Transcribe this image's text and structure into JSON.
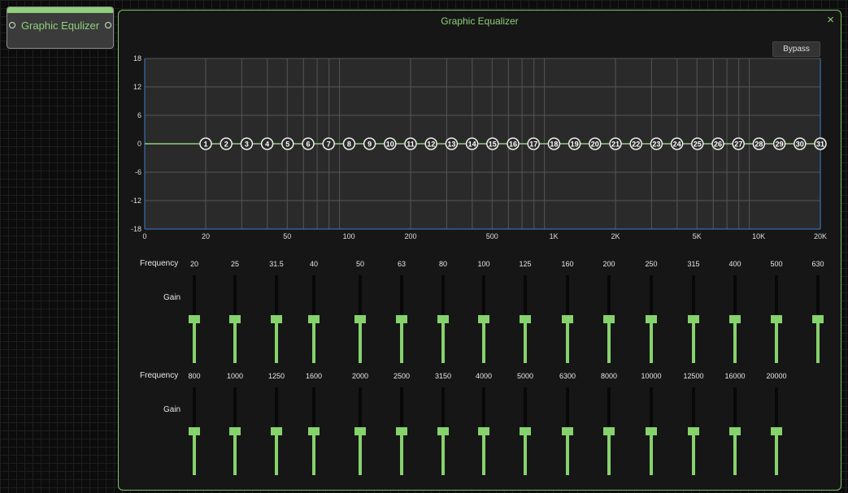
{
  "node": {
    "title": "Graphic Equlizer"
  },
  "window": {
    "title": "Graphic Equalizer",
    "close_glyph": "×",
    "bypass_label": "Bypass"
  },
  "graph": {
    "y_ticks": [
      "18",
      "12",
      "6",
      "0",
      "-6",
      "-12",
      "-18"
    ],
    "x_ticks": [
      {
        "freq": 20,
        "label": "20"
      },
      {
        "freq": 50,
        "label": "50"
      },
      {
        "freq": 100,
        "label": "100"
      },
      {
        "freq": 200,
        "label": "200"
      },
      {
        "freq": 500,
        "label": "500"
      },
      {
        "freq": 1000,
        "label": "1K"
      },
      {
        "freq": 2000,
        "label": "2K"
      },
      {
        "freq": 5000,
        "label": "5K"
      },
      {
        "freq": 10000,
        "label": "10K"
      },
      {
        "freq": 20000,
        "label": "20K"
      }
    ],
    "x_axis_origin_label": "0",
    "bands": [
      "1",
      "2",
      "3",
      "4",
      "5",
      "6",
      "7",
      "8",
      "9",
      "10",
      "11",
      "12",
      "13",
      "14",
      "15",
      "16",
      "17",
      "18",
      "19",
      "20",
      "21",
      "22",
      "23",
      "24",
      "25",
      "26",
      "27",
      "28",
      "29",
      "30",
      "31"
    ],
    "band_gain_db": 0,
    "colors": {
      "curve": "#8fd07a",
      "grid": "#555555",
      "axis": "#3b7fd0",
      "plot_bg": "#2a2a2a"
    }
  },
  "labels": {
    "frequency": "Frequency",
    "gain": "Gain"
  },
  "rows": [
    {
      "frequencies": [
        "20",
        "25",
        "31.5",
        "40",
        "50",
        "63",
        "80",
        "100",
        "125",
        "160",
        "200",
        "250",
        "315",
        "400",
        "500",
        "630"
      ],
      "gain_levels": [
        0.5,
        0.5,
        0.5,
        0.5,
        0.5,
        0.5,
        0.5,
        0.5,
        0.5,
        0.5,
        0.5,
        0.5,
        0.5,
        0.5,
        0.5,
        0.5
      ]
    },
    {
      "frequencies": [
        "800",
        "1000",
        "1250",
        "1600",
        "2000",
        "2500",
        "3150",
        "4000",
        "5000",
        "6300",
        "8000",
        "10000",
        "12500",
        "16000",
        "20000"
      ],
      "gain_levels": [
        0.5,
        0.5,
        0.5,
        0.5,
        0.5,
        0.5,
        0.5,
        0.5,
        0.5,
        0.5,
        0.5,
        0.5,
        0.5,
        0.5,
        0.5
      ]
    }
  ]
}
